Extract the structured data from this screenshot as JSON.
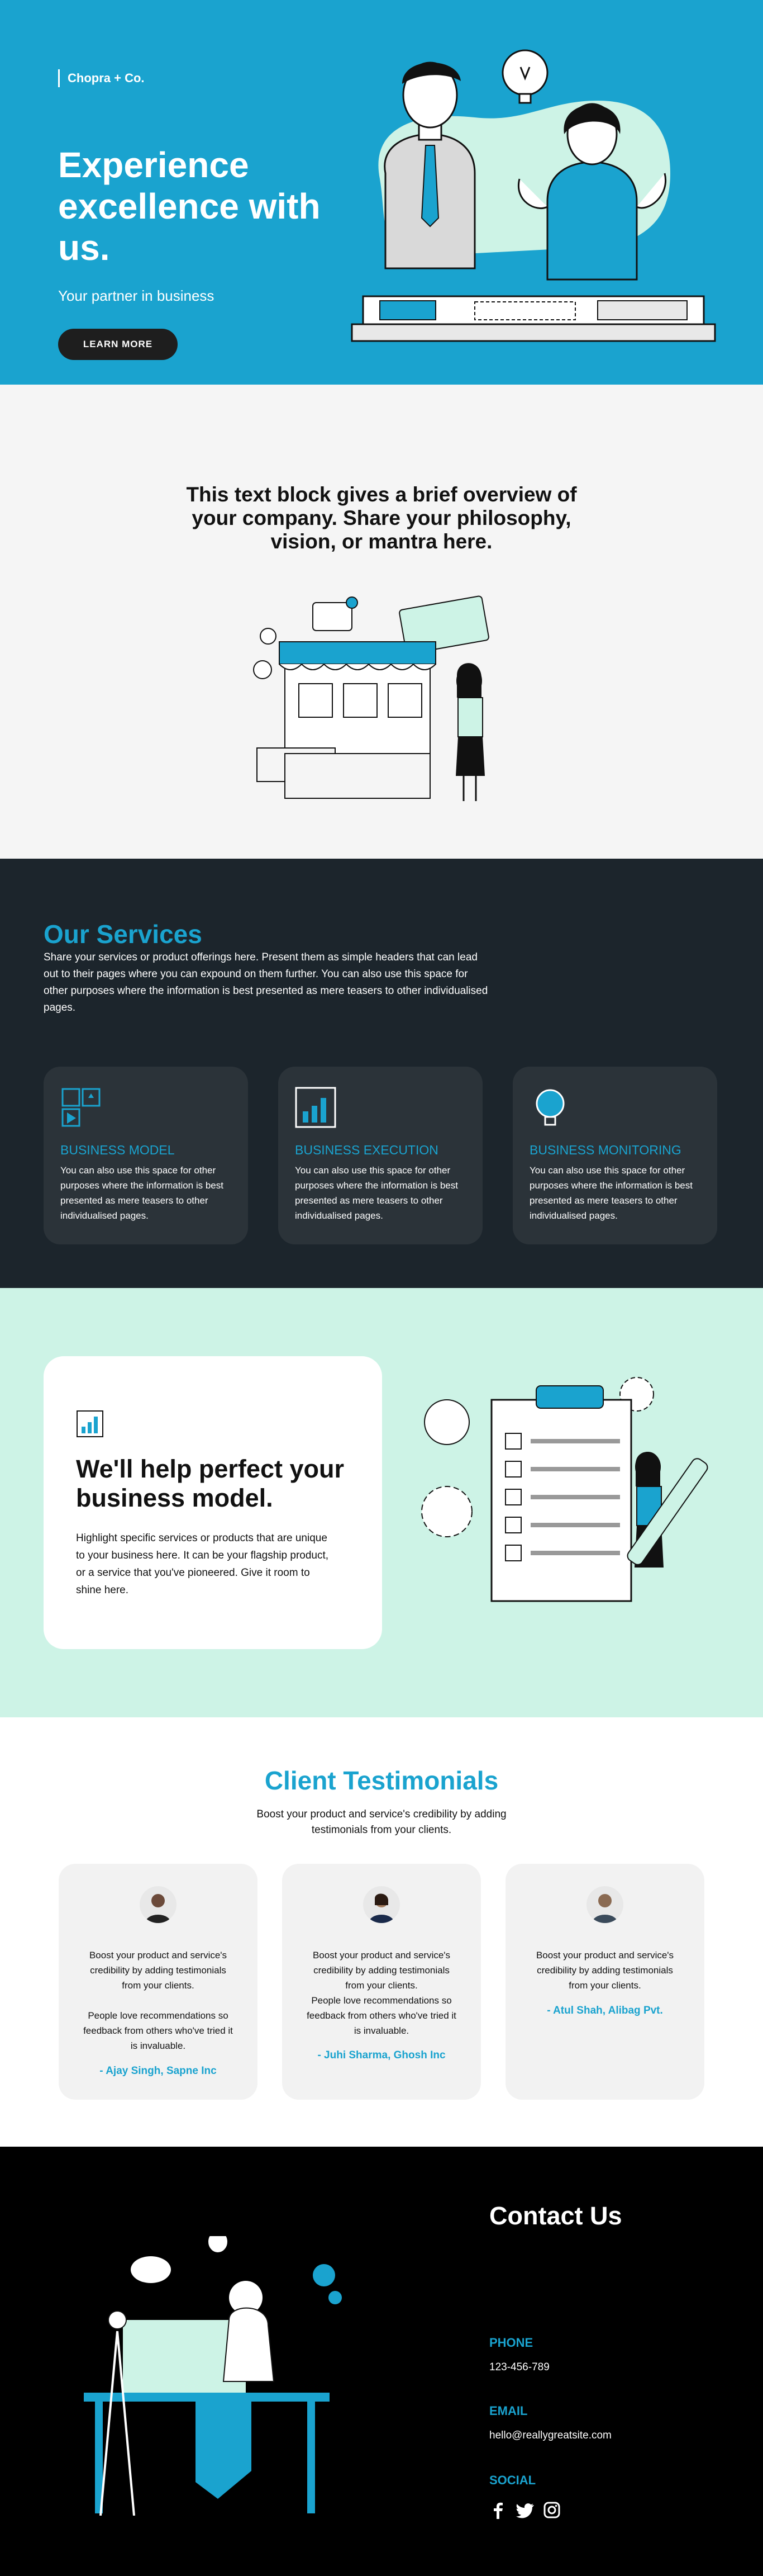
{
  "hero": {
    "brand": "Chopra + Co.",
    "title": "Experience excellence with us.",
    "subtitle": "Your partner in business",
    "cta": "LEARN MORE"
  },
  "overview": {
    "text": "This text block gives a brief overview of your company. Share your philosophy, vision, or mantra here."
  },
  "services": {
    "title": "Our Services",
    "description": "Share your services or product offerings here. Present them as simple headers that can lead out to their pages where you can expound on them further. You can also use this space for other purposes where the information is best presented as mere teasers to other individualised pages.",
    "cards": [
      {
        "icon": "grid-icon",
        "title": "BUSINESS MODEL",
        "text": "You can also use this space for other purposes where the information is best presented as mere teasers to other individualised pages."
      },
      {
        "icon": "bar-chart-icon",
        "title": "BUSINESS EXECUTION",
        "text": "You can also use this space for other purposes where the information is best presented as mere teasers to other individualised pages."
      },
      {
        "icon": "lightbulb-icon",
        "title": "BUSINESS MONITORING",
        "text": "You can also use this space for other purposes where the information is best presented as mere teasers to other individualised pages."
      }
    ]
  },
  "bizmodel": {
    "title": "We'll help perfect your business model.",
    "text": "Highlight specific services or products that are unique to your business here. It can be your flagship product, or a service that you've pioneered. Give it room to shine here."
  },
  "testimonials": {
    "title": "Client Testimonials",
    "subtitle": "Boost your product and service's credibility by adding testimonials from your clients.",
    "items": [
      {
        "quote1": "Boost your product and service's credibility by adding testimonials from your clients.",
        "quote2": "People love recommendations so feedback from others who've tried it is invaluable.",
        "name": "- Ajay Singh, Sapne Inc"
      },
      {
        "quote1": "Boost your product and service's credibility by adding testimonials from your clients.",
        "quote2": "People love recommendations so feedback from others who've tried it is invaluable.",
        "name": "- Juhi Sharma, Ghosh Inc"
      },
      {
        "quote1": "Boost your product and service's credibility by adding testimonials from your clients.",
        "quote2": "",
        "name": "- Atul Shah, Alibag Pvt."
      }
    ]
  },
  "contact": {
    "title": "Contact Us",
    "phone_label": "PHONE",
    "phone": "123-456-789",
    "email_label": "EMAIL",
    "email": "hello@reallygreatsite.com",
    "social_label": "SOCIAL",
    "social_icons": [
      "facebook-icon",
      "twitter-icon",
      "instagram-icon"
    ]
  },
  "colors": {
    "accent": "#1aa3cf",
    "dark": "#1c252c",
    "mint": "#cdf3e6",
    "light_gray": "#f5f5f5",
    "black": "#000000"
  }
}
